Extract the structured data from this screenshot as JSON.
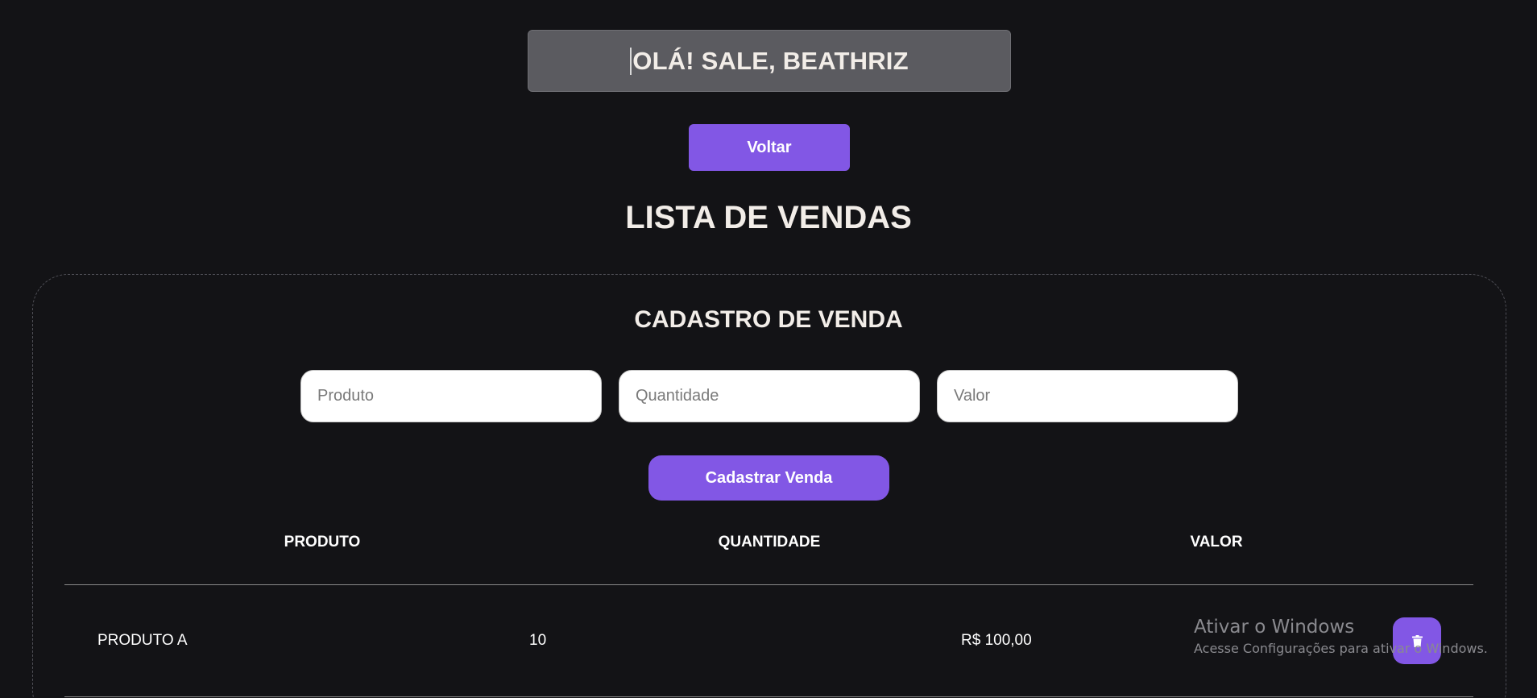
{
  "header": {
    "greeting": "OLÁ! SALE, BEATHRIZ",
    "back_label": "Voltar"
  },
  "page_title": "LISTA DE VENDAS",
  "form": {
    "title": "CADASTRO DE VENDA",
    "fields": [
      {
        "placeholder": "Produto",
        "value": ""
      },
      {
        "placeholder": "Quantidade",
        "value": ""
      },
      {
        "placeholder": "Valor",
        "value": ""
      }
    ],
    "submit_label": "Cadastrar Venda"
  },
  "table": {
    "columns": [
      "PRODUTO",
      "QUANTIDADE",
      "VALOR"
    ],
    "rows": [
      {
        "produto": "PRODUTO A",
        "quantidade": "10",
        "valor": "R$ 100,00"
      }
    ]
  },
  "icons": {
    "delete": "trash-icon"
  },
  "watermark": {
    "title": "Ativar o Windows",
    "subtitle": "Acesse Configurações para ativar o Windows."
  },
  "colors": {
    "background": "#131316",
    "accent": "#8257e5",
    "greeting_bg": "#5b5b60"
  }
}
